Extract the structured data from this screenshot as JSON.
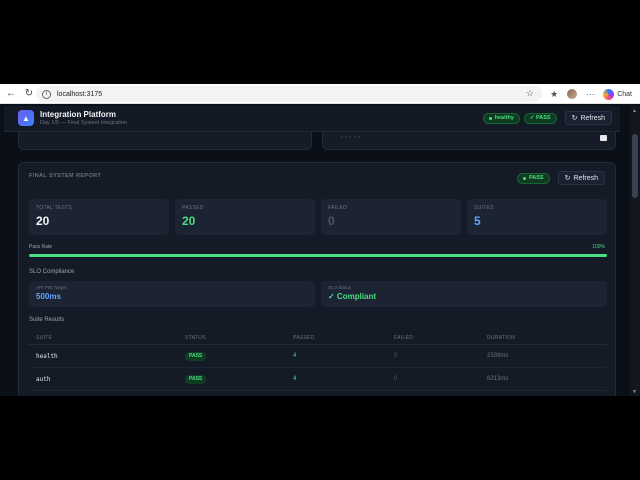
{
  "browser": {
    "url": "localhost:3175",
    "chat_label": "Chat"
  },
  "app": {
    "title": "Integration Platform",
    "subtitle": "Day 1/5 — Final System Integration",
    "health_badge": "healthy",
    "pass_badge": "✓ PASS",
    "refresh_label": "Refresh"
  },
  "report": {
    "title": "FINAL SYSTEM REPORT",
    "status_badge": "PASS",
    "refresh_label": "Refresh",
    "stats": [
      {
        "label": "TOTAL TESTS",
        "value": "20",
        "color": "#f3f4f6"
      },
      {
        "label": "PASSED",
        "value": "20",
        "color": "#4ade80"
      },
      {
        "label": "FAILED",
        "value": "0",
        "color": "#4b5563"
      },
      {
        "label": "SUITES",
        "value": "5",
        "color": "#60a5fa"
      }
    ],
    "pass_rate": {
      "label": "Pass Rate",
      "value": "100%",
      "fraction": 1.0
    },
    "slo": {
      "title": "SLO Compliance",
      "items": [
        {
          "label": "API P95 Target",
          "value": "500ms",
          "color": "#60a5fa"
        },
        {
          "label": "SLO Status",
          "value": "✓ Compliant",
          "color": "#4ade80"
        }
      ]
    },
    "suites": {
      "title": "Suite Results",
      "columns": [
        "SUITE",
        "STATUS",
        "PASSED",
        "FAILED",
        "DURATION"
      ],
      "rows": [
        {
          "suite": "health",
          "status": "PASS",
          "passed": "4",
          "failed": "0",
          "duration": "2339ms"
        },
        {
          "suite": "auth",
          "status": "PASS",
          "passed": "4",
          "failed": "0",
          "duration": "6213ms"
        }
      ]
    }
  },
  "colors": {
    "background": "#0b0f17",
    "card": "#141b27",
    "accent_green": "#4ade80",
    "accent_blue": "#60a5fa"
  }
}
